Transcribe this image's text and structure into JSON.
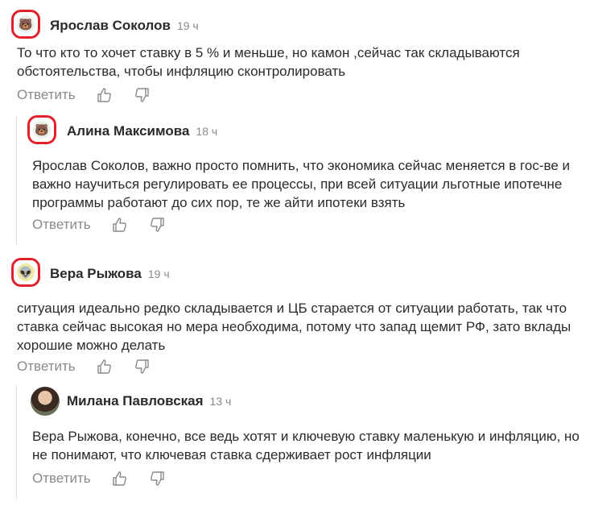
{
  "reply_label": "Ответить",
  "comments": [
    {
      "name": "Ярослав Соколов",
      "time": "19 ч",
      "avatar": "bear-emoji",
      "text": "То что кто то хочет ставку в 5 % и меньше, но камон ,сейчас так складываются обстоятельства, чтобы инфляцию сконтролировать"
    },
    {
      "name": "Алина Максимова",
      "time": "18 ч",
      "avatar": "bear-emoji",
      "text": "Ярослав Соколов, важно просто помнить, что экономика сейчас меняется в гос-ве и важно научиться регулировать ее процессы, при всей ситуации льготные ипотечне программы работают до сих пор, те же айти ипотеки взять"
    },
    {
      "name": "Вера Рыжова",
      "time": "19 ч",
      "avatar": "alien-emoji",
      "text": "ситуация идеально редко складывается и ЦБ старается от ситуации работать, так что ставка сейчас высокая но мера необходима, потому что запад щемит РФ, зато вклады хорошие можно делать"
    },
    {
      "name": "Милана Павловская",
      "time": "13 ч",
      "avatar": "user-photo",
      "text": "Вера Рыжова, конечно, все ведь хотят и ключевую ставку маленькую и инфляцию, но не понимают, что ключевая ставка сдерживает рост инфляции"
    }
  ],
  "colors": {
    "highlight_ring": "#e0212b",
    "muted": "#8a8a8a",
    "text": "#2b2b2b"
  }
}
